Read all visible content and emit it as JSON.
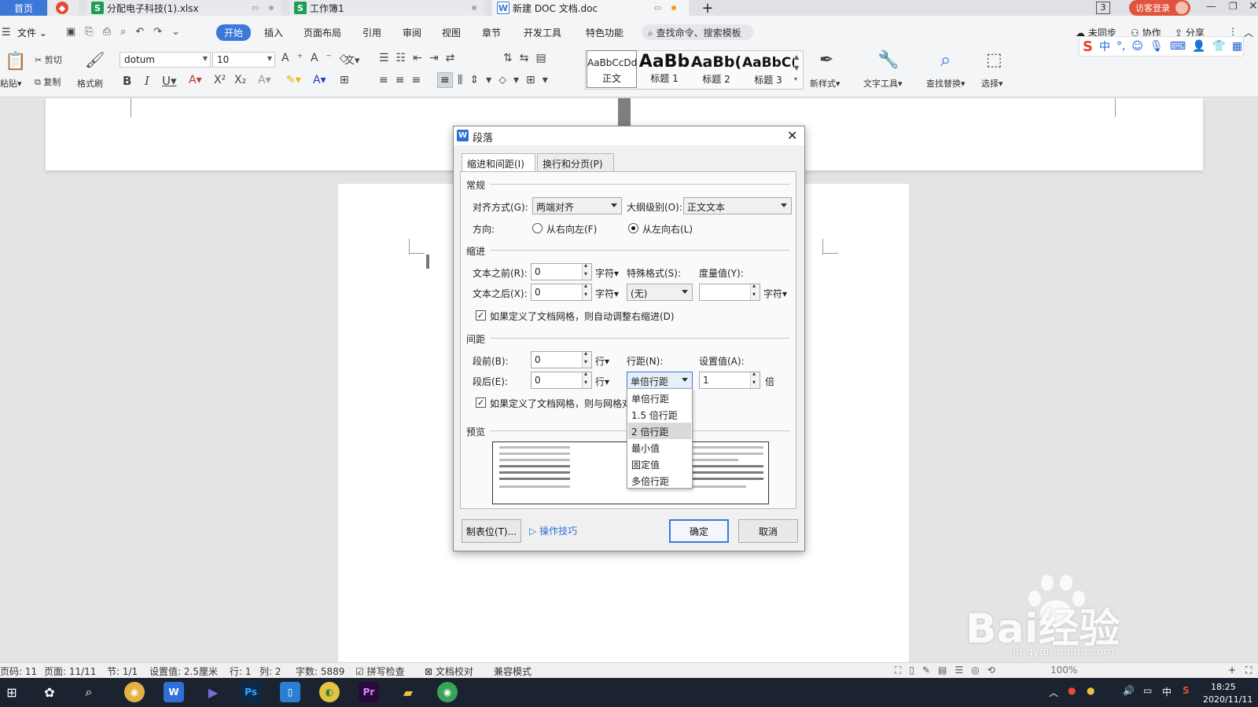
{
  "titlebar": {
    "home_tab": "首页",
    "tabs": [
      {
        "label": "分配电子科技(1).xlsx"
      },
      {
        "label": "工作簿1"
      },
      {
        "label": "新建 DOC 文档.doc"
      }
    ],
    "new_tab": "+",
    "badge": "3",
    "login": "访客登录"
  },
  "menu": {
    "file": "文件",
    "items": [
      "开始",
      "插入",
      "页面布局",
      "引用",
      "审阅",
      "视图",
      "章节",
      "开发工具",
      "特色功能"
    ],
    "search": "查找命令、搜索模板",
    "right": [
      "未同步",
      "协作",
      "分享"
    ]
  },
  "ribbon": {
    "paste": "粘贴",
    "cut": "剪切",
    "copy": "复制",
    "format_painter": "格式刷",
    "font_name": "dotum",
    "font_size": "10",
    "styles": [
      {
        "sample": "AaBbCcDd",
        "name": "正文"
      },
      {
        "sample": "AaBb",
        "name": "标题 1"
      },
      {
        "sample": "AaBb(",
        "name": "标题 2"
      },
      {
        "sample": "AaBbC(",
        "name": "标题 3"
      }
    ],
    "new_style": "新样式",
    "text_tools": "文字工具",
    "find_replace": "查找替换",
    "select": "选择"
  },
  "dialog": {
    "title": "段落",
    "tabs": [
      "缩进和间距(I)",
      "换行和分页(P)"
    ],
    "general": {
      "section": "常规",
      "align_label": "对齐方式(G):",
      "align_value": "两端对齐",
      "outline_label": "大纲级别(O):",
      "outline_value": "正文文本",
      "direction_label": "方向:",
      "rtl": "从右向左(F)",
      "ltr": "从左向右(L)"
    },
    "indent": {
      "section": "缩进",
      "before_label": "文本之前(R):",
      "before_value": "0",
      "before_unit": "字符",
      "after_label": "文本之后(X):",
      "after_value": "0",
      "after_unit": "字符",
      "special_label": "特殊格式(S):",
      "special_value": "(无)",
      "measure_label": "度量值(Y):",
      "measure_value": "",
      "measure_unit": "字符",
      "auto_adjust": "如果定义了文档网格，则自动调整右缩进(D)"
    },
    "spacing": {
      "section": "间距",
      "before_label": "段前(B):",
      "before_value": "0",
      "before_unit": "行",
      "after_label": "段后(E):",
      "after_value": "0",
      "after_unit": "行",
      "line_label": "行距(N):",
      "line_value": "单倍行距",
      "set_label": "设置值(A):",
      "set_value": "1",
      "set_unit": "倍",
      "snap_grid": "如果定义了文档网格，则与网格对"
    },
    "preview": {
      "section": "预览"
    },
    "line_options": [
      "单倍行距",
      "1.5 倍行距",
      "2 倍行距",
      "最小值",
      "固定值",
      "多倍行距"
    ],
    "tabs_button": "制表位(T)...",
    "tips": "操作技巧",
    "ok": "确定",
    "cancel": "取消"
  },
  "statusbar": {
    "items": [
      "页码: 11",
      "页面: 11/11",
      "节: 1/1",
      "设置值: 2.5厘米",
      "行: 1",
      "列: 2",
      "字数: 5889",
      "拼写检查",
      "文档校对",
      "兼容模式"
    ],
    "zoom": "100%"
  },
  "taskbar": {
    "time": "18:25",
    "date": "2020/11/11",
    "ime": "中"
  },
  "watermark": {
    "text": "Bai经验",
    "url": "jingyan.baidu.com"
  }
}
